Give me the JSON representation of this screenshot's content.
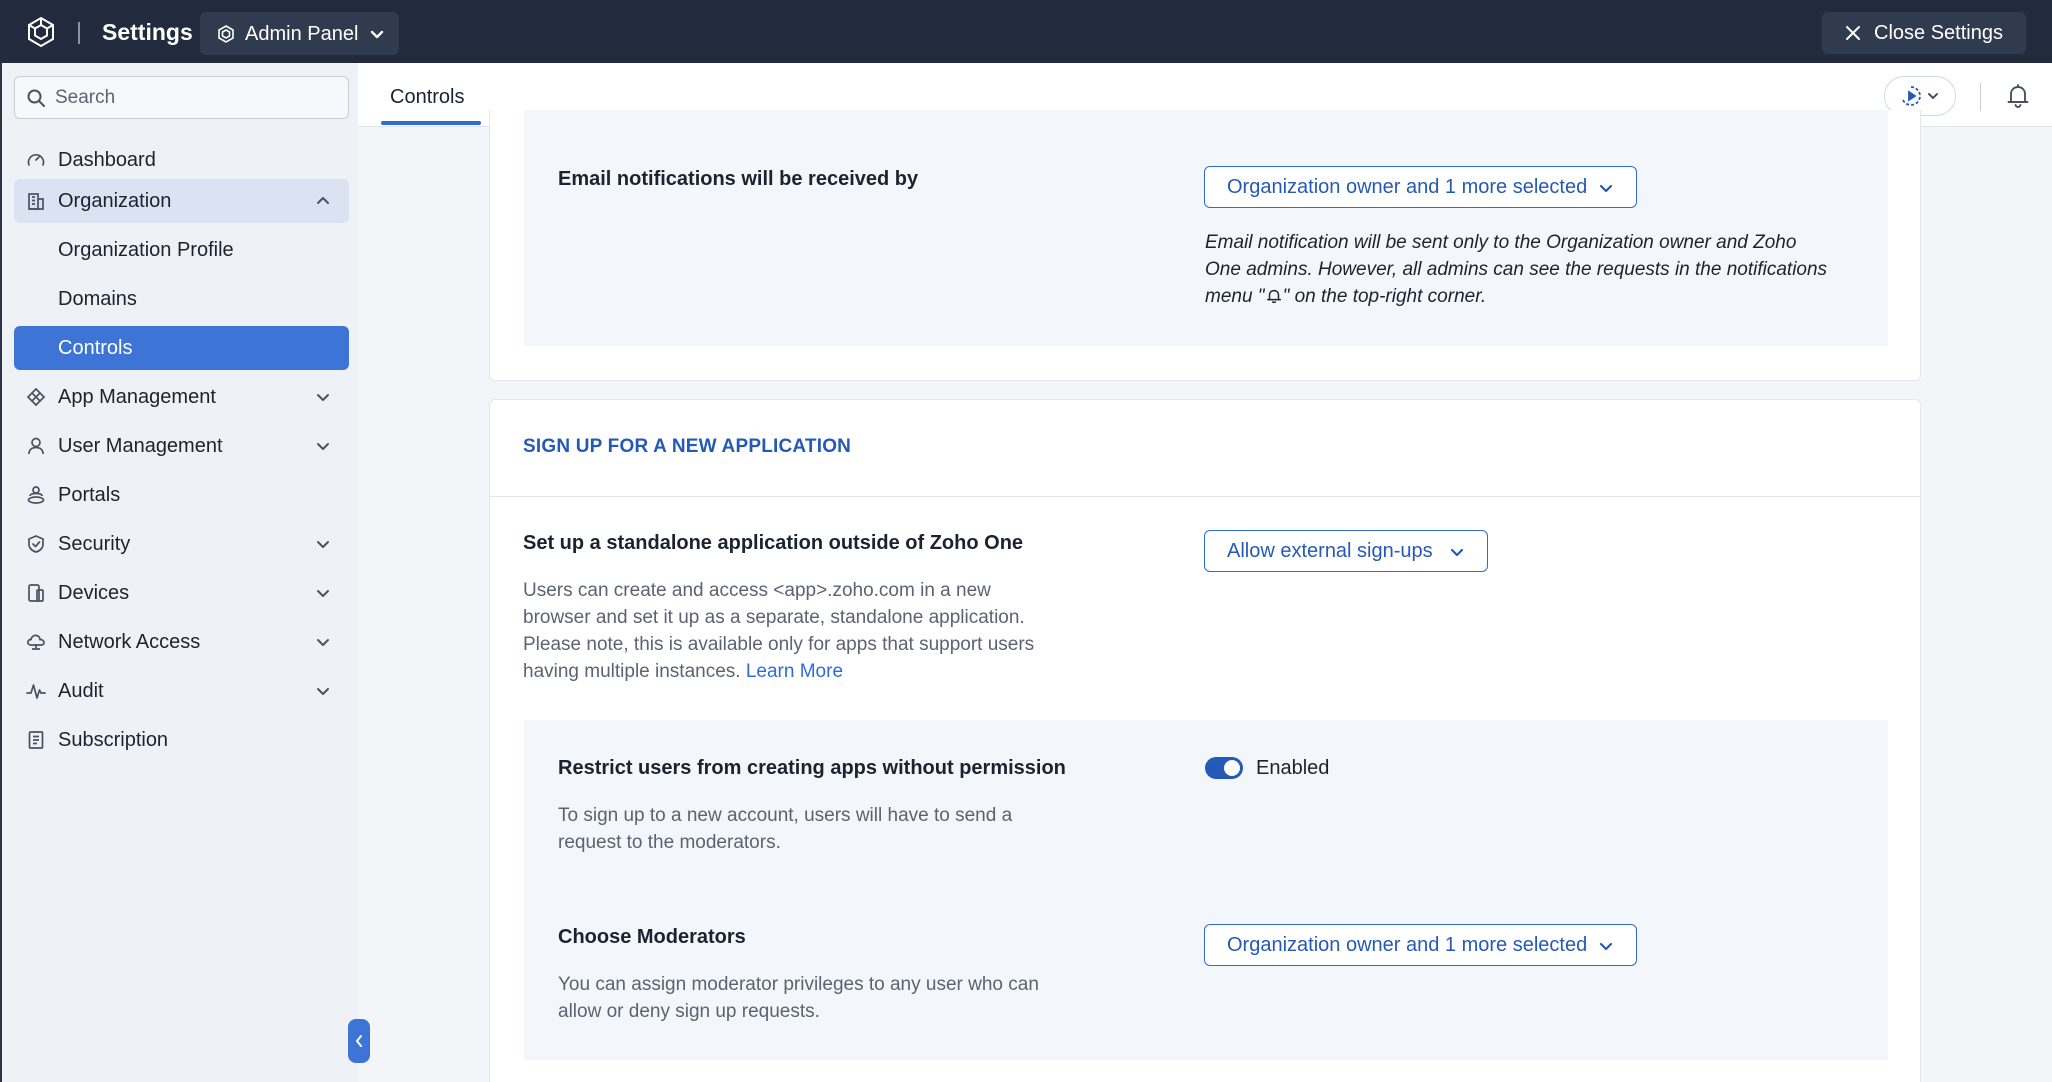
{
  "topbar": {
    "title": "Settings",
    "panel_switch": "Admin Panel",
    "close_label": "Close Settings"
  },
  "sidebar": {
    "search_placeholder": "Search",
    "items": [
      {
        "label": "Dashboard",
        "icon": "dashboard-gauge-icon"
      },
      {
        "label": "Organization",
        "icon": "organization-building-icon",
        "expanded": true
      },
      {
        "label": "Organization Profile"
      },
      {
        "label": "Domains"
      },
      {
        "label": "Controls",
        "active": true
      },
      {
        "label": "App Management",
        "icon": "app-management-icon"
      },
      {
        "label": "User Management",
        "icon": "user-icon"
      },
      {
        "label": "Portals",
        "icon": "portals-icon"
      },
      {
        "label": "Security",
        "icon": "shield-icon"
      },
      {
        "label": "Devices",
        "icon": "devices-icon"
      },
      {
        "label": "Network Access",
        "icon": "cloud-network-icon"
      },
      {
        "label": "Audit",
        "icon": "audit-pulse-icon"
      },
      {
        "label": "Subscription",
        "icon": "subscription-receipt-icon"
      }
    ]
  },
  "header": {
    "tab": "Controls"
  },
  "email_section": {
    "label": "Email notifications will be received by",
    "dropdown": "Organization owner and 1 more selected",
    "note_1": "Email notification will be sent only to the Organization owner and Zoho",
    "note_2": "One admins. However, all admins can see the requests in the notifications",
    "note_3a": "menu \"",
    "note_3b": "\" on the top-right corner."
  },
  "signup_section": {
    "title": "SIGN UP FOR A NEW APPLICATION",
    "standalone_label": "Set up a standalone application outside of Zoho One",
    "standalone_desc_1": "Users can create and access <app>.zoho.com in a new",
    "standalone_desc_2": "browser and set it up as a separate, standalone application.",
    "standalone_desc_3": "Please note, this is available only for apps that support users",
    "standalone_desc_4": "having multiple instances.",
    "learn_more": "Learn More",
    "standalone_dropdown": "Allow external sign-ups",
    "restrict_label": "Restrict users from creating apps without permission",
    "restrict_desc_1": "To sign up to a new account, users will have to send a",
    "restrict_desc_2": "request to the moderators.",
    "restrict_toggle": "Enabled",
    "moderators_label": "Choose Moderators",
    "moderators_desc_1": "You can assign moderator privileges to any user who can",
    "moderators_desc_2": "allow or deny sign up requests.",
    "moderators_dropdown": "Organization owner and 1 more selected"
  }
}
